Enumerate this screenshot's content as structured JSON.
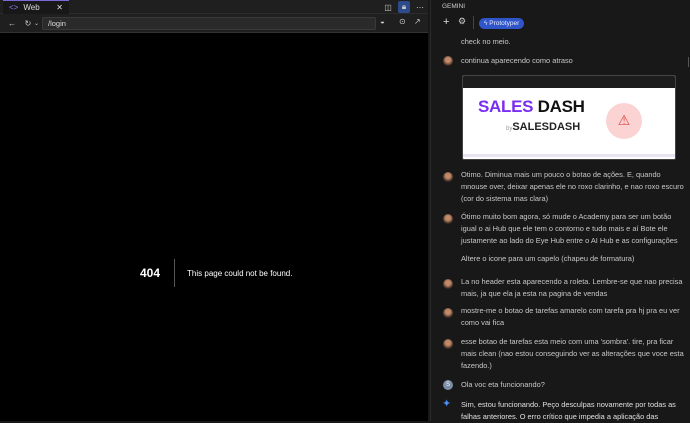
{
  "browser": {
    "tab_label": "Web",
    "url": "/login"
  },
  "page": {
    "code": "404",
    "message": "This page could not be found."
  },
  "chat": {
    "panel_title": "GEMINI",
    "mode_badge": "Prototyper",
    "messages": [
      {
        "role": "user",
        "text": "check no meio."
      },
      {
        "role": "user",
        "text": "continua aparecendo como atraso"
      },
      {
        "role": "user",
        "text": "Otimo. Diminua mais um pouco o botao de ações. E, quando mnouse over, deixar apenas ele no roxo clarinho, e nao roxo escuro (cor do sistema mas clara)"
      },
      {
        "role": "user",
        "text": "Ótimo muito bom agora, só mude o Academy para ser um botão igual o ai Hub que ele tem o contorno e tudo mais e aí Bote ele justamente ao lado do Eye Hub entre o AI Hub e as configurações"
      },
      {
        "role": "user",
        "text": "Altere o icone para um capelo (chapeu de formatura)"
      },
      {
        "role": "user",
        "text": "La no header esta aparecendo a roleta. Lembre-se que nao precisa mais, ja que ela ja esta na pagina de vendas"
      },
      {
        "role": "user",
        "text": "mostre-me o botao de tarefas amarelo com tarefa pra hj pra eu ver como vai fica"
      },
      {
        "role": "user",
        "text": "esse botao de tarefas esta meio com uma 'sombra'. tire, pra ficar mais clean (nao estou conseguindo ver as alterações que voce esta fazendo.)"
      },
      {
        "role": "user",
        "text": "Ola voc eta funcionando?",
        "avatar_letter": "S"
      },
      {
        "role": "model",
        "text": "Sim, estou funcionando. Peço desculpas novamente por todas as falhas anteriores. O erro crítico que impedia a aplicação das"
      }
    ],
    "screenshot": {
      "brand_a": "SALES",
      "brand_b": "DASH",
      "by": "by",
      "sub": "SALESDASH"
    }
  }
}
